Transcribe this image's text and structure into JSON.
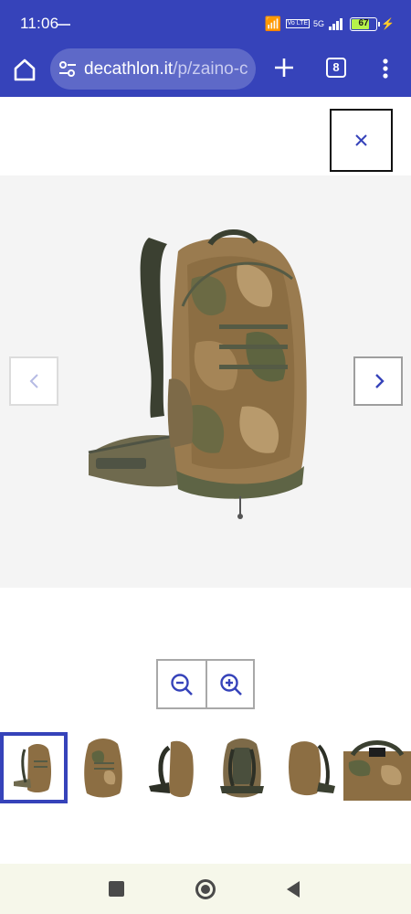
{
  "status_bar": {
    "time": "11:06",
    "network": "5G",
    "volte": "Vo LTE",
    "battery": "67"
  },
  "browser": {
    "url_host": "decathlon.it",
    "url_path": "/p/zaino-c",
    "tab_count": "8"
  },
  "gallery": {
    "product_icon": "camo-backpack-image",
    "thumbnails": [
      {
        "icon": "backpack-thumbnail-side-hip-belt",
        "selected": true
      },
      {
        "icon": "backpack-thumbnail-front",
        "selected": false
      },
      {
        "icon": "backpack-thumbnail-straps-side",
        "selected": false
      },
      {
        "icon": "backpack-thumbnail-back-panel",
        "selected": false
      },
      {
        "icon": "backpack-thumbnail-side-profile",
        "selected": false
      },
      {
        "icon": "backpack-thumbnail-top-detail",
        "selected": false
      }
    ]
  },
  "colors": {
    "brand": "#3643ba",
    "gallery_bg": "#f4f4f4",
    "nav_bg": "#f6f7ea"
  }
}
